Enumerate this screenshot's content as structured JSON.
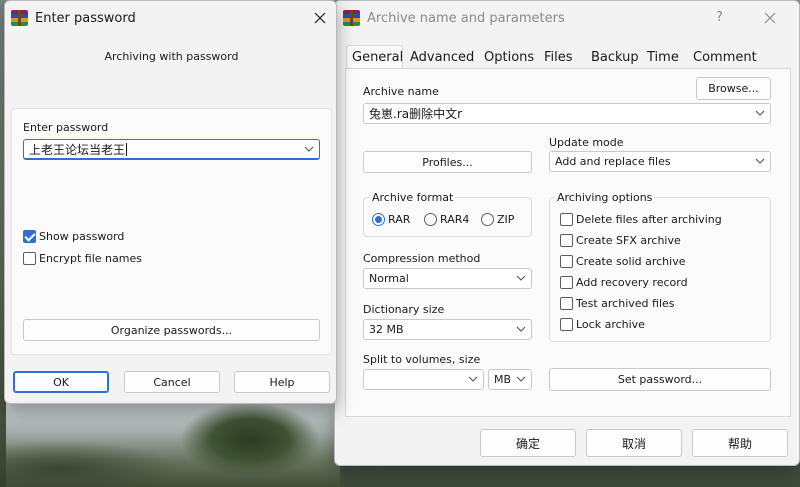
{
  "password_dialog": {
    "title": "Enter password",
    "heading": "Archiving with password",
    "enter_label": "Enter password",
    "password_value": "上老王论坛当老王",
    "show_password_label": "Show password",
    "show_password_checked": true,
    "encrypt_label": "Encrypt file names",
    "encrypt_checked": false,
    "organize_label": "Organize passwords...",
    "ok_label": "OK",
    "cancel_label": "Cancel",
    "help_label": "Help"
  },
  "archive_dialog": {
    "title": "Archive name and parameters",
    "help_icon": "?",
    "tabs": [
      "General",
      "Advanced",
      "Options",
      "Files",
      "Backup",
      "Time",
      "Comment"
    ],
    "active_tab": "General",
    "archive_name_label": "Archive name",
    "archive_name_value": "兔崽.ra删除中文r",
    "browse_label": "Browse...",
    "update_mode_label": "Update mode",
    "update_mode_value": "Add and replace files",
    "profiles_label": "Profiles...",
    "archive_format_label": "Archive format",
    "formats": [
      "RAR",
      "RAR4",
      "ZIP"
    ],
    "selected_format": "RAR",
    "archiving_options_label": "Archiving options",
    "options": [
      {
        "label": "Delete files after archiving",
        "checked": false
      },
      {
        "label": "Create SFX archive",
        "checked": false
      },
      {
        "label": "Create solid archive",
        "checked": false
      },
      {
        "label": "Add recovery record",
        "checked": false
      },
      {
        "label": "Test archived files",
        "checked": false
      },
      {
        "label": "Lock archive",
        "checked": false
      }
    ],
    "compression_label": "Compression method",
    "compression_value": "Normal",
    "dictionary_label": "Dictionary size",
    "dictionary_value": "32 MB",
    "split_label": "Split to volumes, size",
    "split_value": "",
    "split_unit": "MB",
    "set_password_label": "Set password...",
    "ok_label": "确定",
    "cancel_label": "取消",
    "help_label": "帮助"
  },
  "colors": {
    "accent": "#2f6fd1",
    "window_bg": "#f3f3f3"
  }
}
